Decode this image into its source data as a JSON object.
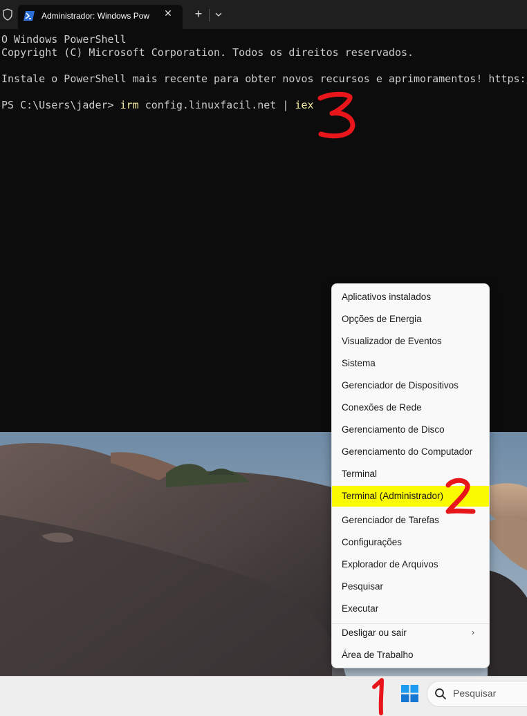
{
  "window": {
    "tab_title": "Administrador: Windows Pow",
    "new_tab_label": "+"
  },
  "terminal": {
    "lines": [
      "O Windows PowerShell",
      "Copyright (C) Microsoft Corporation. Todos os direitos reservados.",
      "Instale o PowerShell mais recente para obter novos recursos e aprimoramentos! https://"
    ],
    "prompt": "PS C:\\Users\\jader> ",
    "cmd1": "irm",
    "arg": " config.linuxfacil.net | ",
    "cmd2": "iex"
  },
  "annotations": {
    "step1": "1",
    "step2": "2",
    "step3": "3",
    "color": "#e8151b"
  },
  "context_menu": {
    "items": [
      "Aplicativos instalados",
      "Opções de Energia",
      "Visualizador de Eventos",
      "Sistema",
      "Gerenciador de Dispositivos",
      "Conexões de Rede",
      "Gerenciamento de Disco",
      "Gerenciamento do Computador",
      "Terminal",
      "Terminal (Administrador)",
      "Gerenciador de Tarefas",
      "Configurações",
      "Explorador de Arquivos",
      "Pesquisar",
      "Executar",
      "Desligar ou sair",
      "Área de Trabalho"
    ],
    "highlighted": "Terminal (Administrador)",
    "highlight_color": "#fafa00"
  },
  "taskbar": {
    "search_placeholder": "Pesquisar",
    "start_icon": "windows-logo-icon"
  }
}
